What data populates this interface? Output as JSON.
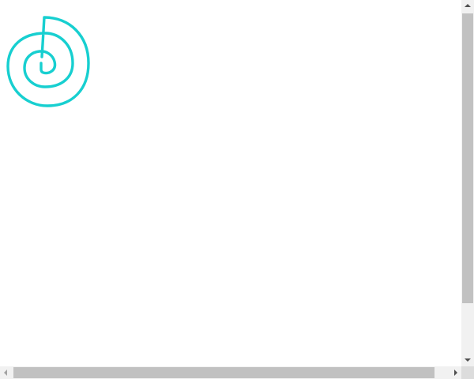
{
  "canvas": {
    "background": "#ffffff"
  },
  "drawing": {
    "shape": "spiral",
    "stroke_color": "#17cfd0"
  },
  "scrollbars": {
    "vertical": {
      "up_icon": "arrow-up-icon",
      "down_icon": "arrow-down-icon"
    },
    "horizontal": {
      "left_icon": "arrow-left-icon",
      "right_icon": "arrow-right-icon"
    }
  }
}
